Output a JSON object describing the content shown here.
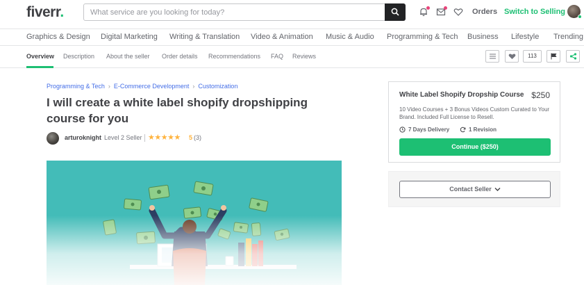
{
  "header": {
    "logo_text": "fiverr",
    "logo_dot": ".",
    "search_placeholder": "What service are you looking for today?",
    "orders_label": "Orders",
    "switch_label": "Switch to Selling"
  },
  "categories": [
    "Graphics & Design",
    "Digital Marketing",
    "Writing & Translation",
    "Video & Animation",
    "Music & Audio",
    "Programming & Tech",
    "Business",
    "Lifestyle",
    "Trending"
  ],
  "subnav": {
    "tabs": [
      "Overview",
      "Description",
      "About the seller",
      "Order details",
      "Recommendations",
      "FAQ",
      "Reviews"
    ],
    "active_tab": "Overview",
    "save_count": "113"
  },
  "breadcrumb": [
    "Programming & Tech",
    "E-Commerce Development",
    "Customization"
  ],
  "gig": {
    "title": "I will create a white label shopify dropshipping course for you",
    "seller_name": "arturoknight",
    "seller_level": "Level 2 Seller",
    "stars": "★★★★★",
    "rating": "5",
    "reviews": "(3)"
  },
  "package": {
    "title": "White Label Shopify Dropship Course",
    "price": "$250",
    "description": "10 Video Courses + 3 Bonus Videos Custom Curated to Your Brand. Included Full License to Resell.",
    "delivery": "7 Days Delivery",
    "revisions": "1 Revision",
    "continue_label": "Continue ($250)"
  },
  "contact": {
    "label": "Contact Seller"
  },
  "colors": {
    "brand_green": "#1dbf73",
    "hero_teal": "#43bcb8",
    "star": "#ffb33e",
    "link_blue": "#446ee7"
  },
  "icons": [
    "search-icon",
    "bell-icon",
    "envelope-icon",
    "heart-icon",
    "list-icon",
    "flag-icon",
    "share-icon",
    "clock-icon",
    "refresh-icon",
    "chevron-down-icon"
  ]
}
